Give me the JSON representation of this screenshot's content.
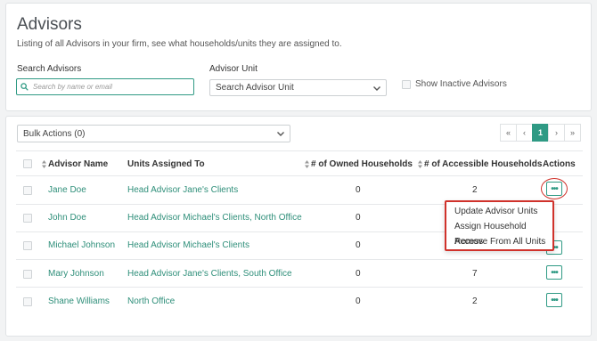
{
  "header": {
    "title": "Advisors",
    "subtitle": "Listing of all Advisors in your firm, see what households/units they are assigned to."
  },
  "filters": {
    "search_label": "Search Advisors",
    "search_placeholder": "Search by name or email",
    "unit_label": "Advisor Unit",
    "unit_value": "Search Advisor Unit",
    "show_inactive_label": "Show Inactive Advisors"
  },
  "bulk": {
    "label": "Bulk Actions (0)"
  },
  "pagination": {
    "first": "«",
    "prev": "‹",
    "current": "1",
    "next": "›",
    "last": "»"
  },
  "table": {
    "headers": {
      "name": "Advisor Name",
      "units": "Units Assigned To",
      "owned": "# of Owned Households",
      "accessible": "# of Accessible Households",
      "actions": "Actions"
    },
    "rows": [
      {
        "name": "Jane Doe",
        "units": "Head Advisor Jane's Clients",
        "owned": "0",
        "accessible": "2"
      },
      {
        "name": "John Doe",
        "units": "Head Advisor Michael's Clients, North Office",
        "owned": "0",
        "accessible": ""
      },
      {
        "name": "Michael Johnson",
        "units": "Head Advisor Michael's Clients",
        "owned": "0",
        "accessible": ""
      },
      {
        "name": "Mary Johnson",
        "units": "Head Advisor Jane's Clients, South Office",
        "owned": "0",
        "accessible": "7"
      },
      {
        "name": "Shane Williams",
        "units": "North Office",
        "owned": "0",
        "accessible": "2"
      }
    ],
    "action_glyph": "•••"
  },
  "actions_menu": {
    "items": [
      "Update Advisor Units",
      "Assign Household Access",
      "Remove From All Units"
    ]
  },
  "colors": {
    "accent": "#2f9a84",
    "highlight": "#d0322b"
  }
}
